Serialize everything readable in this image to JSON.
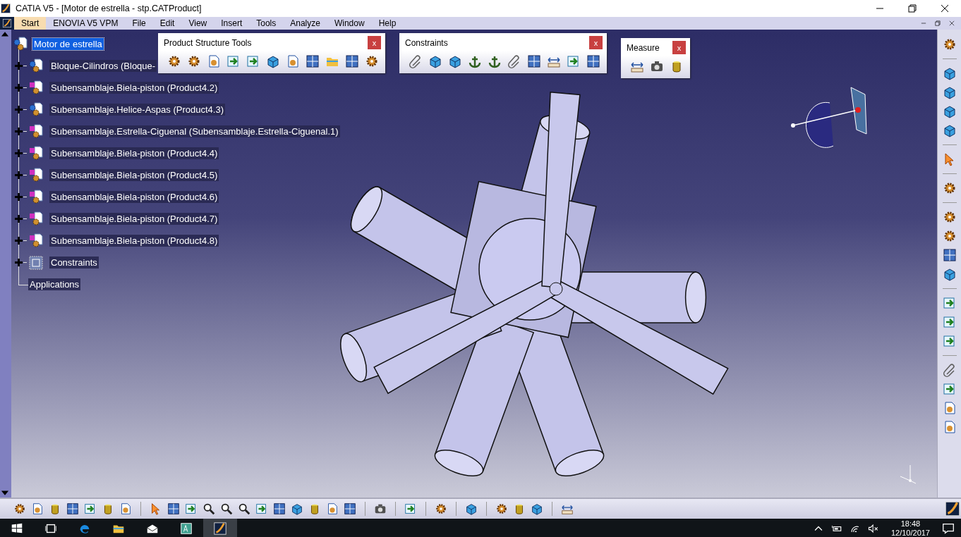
{
  "window": {
    "title": "CATIA V5 - [Motor de estrella - stp.CATProduct]"
  },
  "menu": [
    {
      "label": "Start",
      "selected": true
    },
    {
      "label": "ENOVIA V5 VPM",
      "selected": false
    },
    {
      "label": "File",
      "selected": false
    },
    {
      "label": "Edit",
      "selected": false
    },
    {
      "label": "View",
      "selected": false
    },
    {
      "label": "Insert",
      "selected": false
    },
    {
      "label": "Tools",
      "selected": false
    },
    {
      "label": "Analyze",
      "selected": false
    },
    {
      "label": "Window",
      "selected": false
    },
    {
      "label": "Help",
      "selected": false
    }
  ],
  "tree": {
    "root": {
      "label": "Motor de estrella",
      "selected": true
    },
    "children": [
      {
        "label": "Bloque-Cilindros (Bloque-",
        "kind": "product",
        "selected": false
      },
      {
        "label": "Subensamblaje.Biela-piston (Product4.2)",
        "kind": "assembly",
        "selected": false
      },
      {
        "label": "Subensamblaje.Helice-Aspas (Product4.3)",
        "kind": "product",
        "selected": false
      },
      {
        "label": "Subensamblaje.Estrella-Ciguenal (Subensamblaje.Estrella-Ciguenal.1)",
        "kind": "assembly",
        "selected": false
      },
      {
        "label": "Subensamblaje.Biela-piston (Product4.4)",
        "kind": "assembly",
        "selected": false
      },
      {
        "label": "Subensamblaje.Biela-piston (Product4.5)",
        "kind": "assembly",
        "selected": false
      },
      {
        "label": "Subensamblaje.Biela-piston (Product4.6)",
        "kind": "assembly",
        "selected": false
      },
      {
        "label": "Subensamblaje.Biela-piston (Product4.7)",
        "kind": "assembly",
        "selected": false
      },
      {
        "label": "Subensamblaje.Biela-piston (Product4.8)",
        "kind": "assembly",
        "selected": false
      },
      {
        "label": "Constraints",
        "kind": "constraints",
        "selected": false
      },
      {
        "label": "Applications",
        "kind": "leaf",
        "selected": false
      }
    ]
  },
  "toolbars": [
    {
      "title": "Product Structure Tools",
      "close": "x"
    },
    {
      "title": "Constraints",
      "close": "x"
    },
    {
      "title": "Measure",
      "close": "x"
    }
  ],
  "taskbar": {
    "time": "18:48",
    "date": "12/10/2017"
  }
}
